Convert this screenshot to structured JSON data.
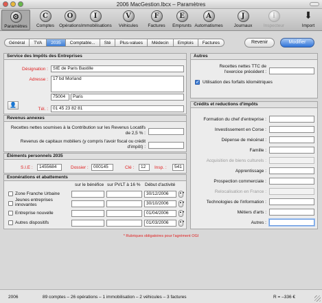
{
  "window": {
    "title": "2006 MacGestion.lbcx – Paramètres"
  },
  "toolbar": {
    "items": [
      {
        "label": "Paramètres",
        "letter": "",
        "active": true
      },
      {
        "label": "Comptes",
        "letter": "C"
      },
      {
        "label": "Opérations",
        "letter": "O"
      },
      {
        "label": "Immobilisations",
        "letter": "I"
      },
      {
        "label": "Véhicules",
        "letter": "V"
      },
      {
        "label": "Factures",
        "letter": "F"
      },
      {
        "label": "Emprunts",
        "letter": "E"
      },
      {
        "label": "Automatismes",
        "letter": "A"
      },
      {
        "label": "Journaux",
        "letter": "J"
      },
      {
        "label": "Inspecteur",
        "letter": "i",
        "disabled": true
      },
      {
        "label": "Import",
        "letter": "⬇"
      }
    ]
  },
  "tabs": [
    "Général",
    "TVA",
    "2035",
    "Comptable...",
    "Sté",
    "Plus-values",
    "Médecin",
    "Emplois",
    "Factures"
  ],
  "selected_tab": "2035",
  "buttons": {
    "revenir": "Revenir",
    "modifier": "Modifier"
  },
  "service_impots": {
    "title": "Service des Impôts des Entreprises",
    "designation_label": "Désignation :",
    "designation": "SIE de Paris Bastille",
    "adresse_label": "Adresse :",
    "adresse": "17 bd Morland",
    "code_postal": "75004",
    "ville": "Paris",
    "tel_label": "Tél. :",
    "tel": "01 45 23 82 81"
  },
  "revenus_annexes": {
    "title": "Revenus annexes",
    "recettes_label": "Recettes nettes soumises à la Contribution sur les Revenus Locatifs de 2,5 % :",
    "capitaux_label": "Revenus de capitaux mobiliers (y compris l'avoir fiscal ou crédit d'impôt) :"
  },
  "elements_2035": {
    "title": "Éléments personnels 2035",
    "sie_label": "S.I.E :",
    "sie": "1455684",
    "dossier_label": "Dossier :",
    "dossier": "000145",
    "cle_label": "Clé :",
    "cle": "12",
    "insp_label": "Insp. :",
    "insp": "541"
  },
  "exonerations": {
    "title": "Exonérations et abattements",
    "col_benefice": "sur le bénéfice",
    "col_pvlt": "sur PVLT à 16 %",
    "col_debut": "Début d'activité",
    "rows": [
      {
        "label": "Zone Franche Urbaine",
        "date": "30/12/2006"
      },
      {
        "label": "Jeunes entreprises innovantes",
        "date": "30/10/2006"
      },
      {
        "label": "Entreprise nouvelle",
        "date": "01/04/2006"
      },
      {
        "label": "Autres dispositifs",
        "date": "01/03/2006"
      }
    ]
  },
  "autres": {
    "title": "Autres",
    "recettes_label": "Recettes nettes TTC de l'exercice précédent :",
    "forfaits_label": "Utilisation des forfaits kilométriques",
    "forfaits_checked": true
  },
  "credits": {
    "title": "Crédits et reductions d'impôts",
    "items": [
      {
        "label": "Formation du chef d'entreprise :",
        "disabled": false
      },
      {
        "label": "Investissement en Corse :",
        "disabled": false
      },
      {
        "label": "Dépense de mécénat :",
        "disabled": false
      },
      {
        "label": "Famille :",
        "disabled": false
      },
      {
        "label": "Acquisition de biens culturels :",
        "disabled": true
      },
      {
        "label": "Apprentissage :",
        "disabled": false
      },
      {
        "label": "Prospection commerciale :",
        "disabled": false
      },
      {
        "label": "Relocalisation en France :",
        "disabled": true
      },
      {
        "label": "Technologies de l'information :",
        "disabled": false
      },
      {
        "label": "Métiers d'arts :",
        "disabled": false
      },
      {
        "label": "Autres :",
        "disabled": false
      }
    ]
  },
  "footnote": "* Rubriques obligatoires pour l'agrément OGI",
  "status": {
    "year": "2006",
    "summary": "89 comptes – 26 opérations – 1 immobilisation – 2 véhicules – 3 factures",
    "result": "R = –336 €"
  }
}
